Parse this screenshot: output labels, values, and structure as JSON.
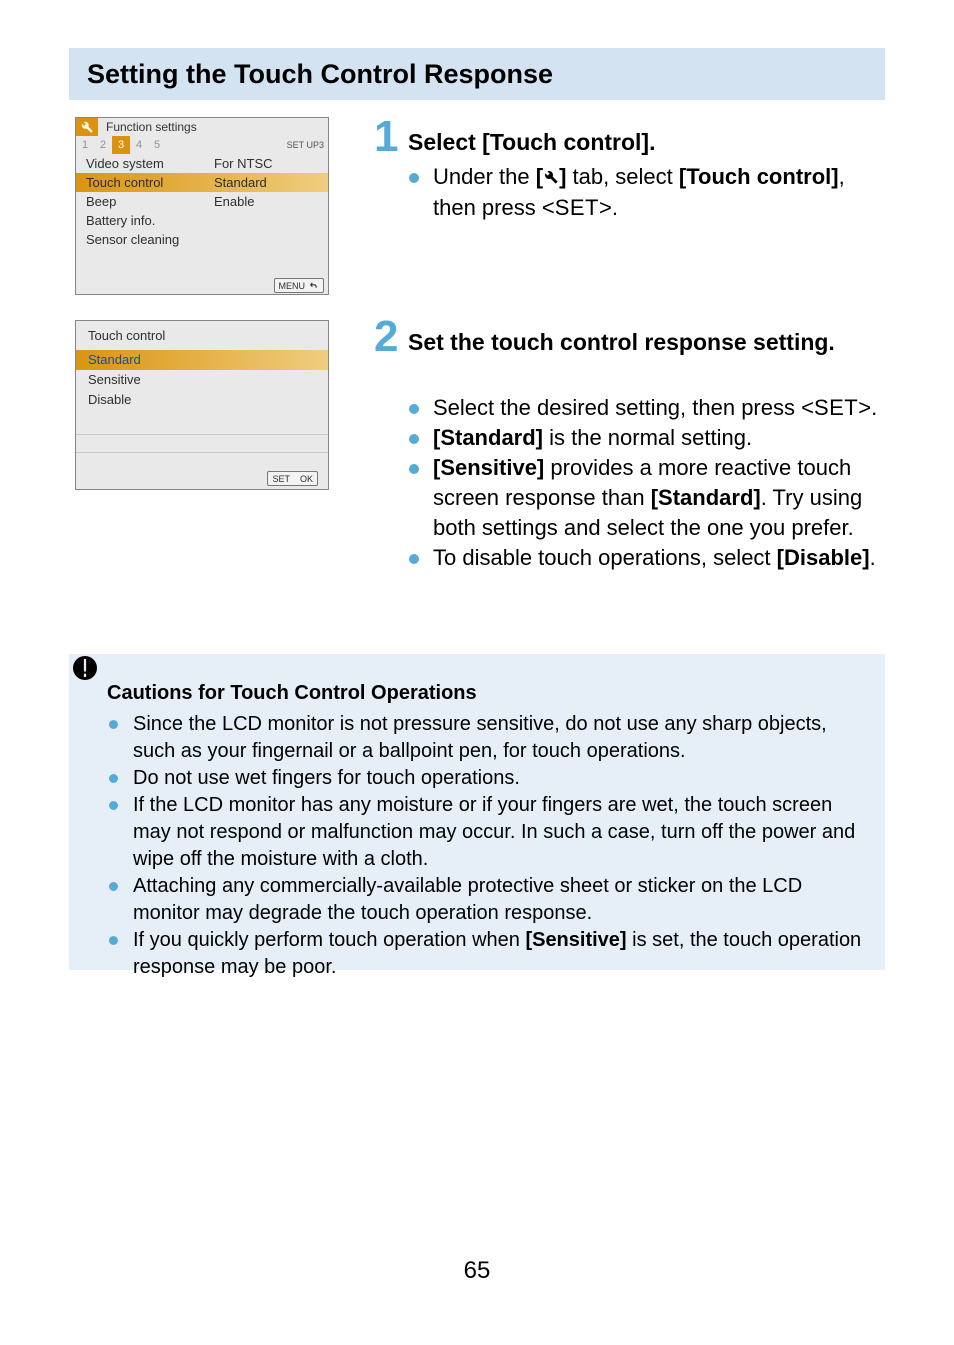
{
  "title": "Setting the Touch Control Response",
  "page_number": "65",
  "screenshot1": {
    "tab_label": "Function settings",
    "tabs": [
      "1",
      "2",
      "3",
      "4",
      "5"
    ],
    "active_tab_index": 2,
    "setup_label": "SET UP3",
    "rows": [
      {
        "label": "Video system",
        "value": "For NTSC"
      },
      {
        "label": "Touch control",
        "value": "Standard"
      },
      {
        "label": "Beep",
        "value": "Enable"
      },
      {
        "label": "Battery info.",
        "value": ""
      },
      {
        "label": "Sensor cleaning",
        "value": ""
      }
    ],
    "selected_row_index": 1,
    "footer_button": "MENU"
  },
  "screenshot2": {
    "title": "Touch control",
    "options": [
      "Standard",
      "Sensitive",
      "Disable"
    ],
    "selected_index": 0,
    "footer_set": "SET",
    "footer_ok": "OK"
  },
  "step1": {
    "number": "1",
    "heading": "Select [Touch control].",
    "b1_a": "Under the ",
    "b1_b": " tab, select ",
    "b1_bold1": "[Touch control]",
    "b1_c": ", then press <",
    "b1_set": "SET",
    "b1_d": ">."
  },
  "step2": {
    "number": "2",
    "heading": "Set the touch control response setting.",
    "b1_a": "Select the desired setting, then press <",
    "b1_set": "SET",
    "b1_b": ">.",
    "b2_bold": "[Standard]",
    "b2_a": " is the normal setting.",
    "b3_bold1": "[Sensitive]",
    "b3_a": " provides a more reactive touch screen response than ",
    "b3_bold2": "[Standard]",
    "b3_b": ". Try using both settings and select the one you prefer.",
    "b4_a": "To disable touch operations, select ",
    "b4_bold": "[Disable]",
    "b4_b": "."
  },
  "caution": {
    "title": "Cautions for Touch Control Operations",
    "items": [
      {
        "a": "Since the LCD monitor is not pressure sensitive, do not use any sharp objects, such as your fingernail or a ballpoint pen, for touch operations."
      },
      {
        "a": "Do not use wet fingers for touch operations."
      },
      {
        "a": "If the LCD monitor has any moisture or if your fingers are wet, the touch screen may not respond or malfunction may occur. In such a case, turn off the power and wipe off the moisture with a cloth."
      },
      {
        "a": "Attaching any commercially-available protective sheet or sticker on the LCD monitor may degrade the touch operation response."
      },
      {
        "a": "If you quickly perform touch operation when ",
        "bold": "[Sensitive]",
        "b": " is set, the touch operation response may be poor."
      }
    ]
  }
}
